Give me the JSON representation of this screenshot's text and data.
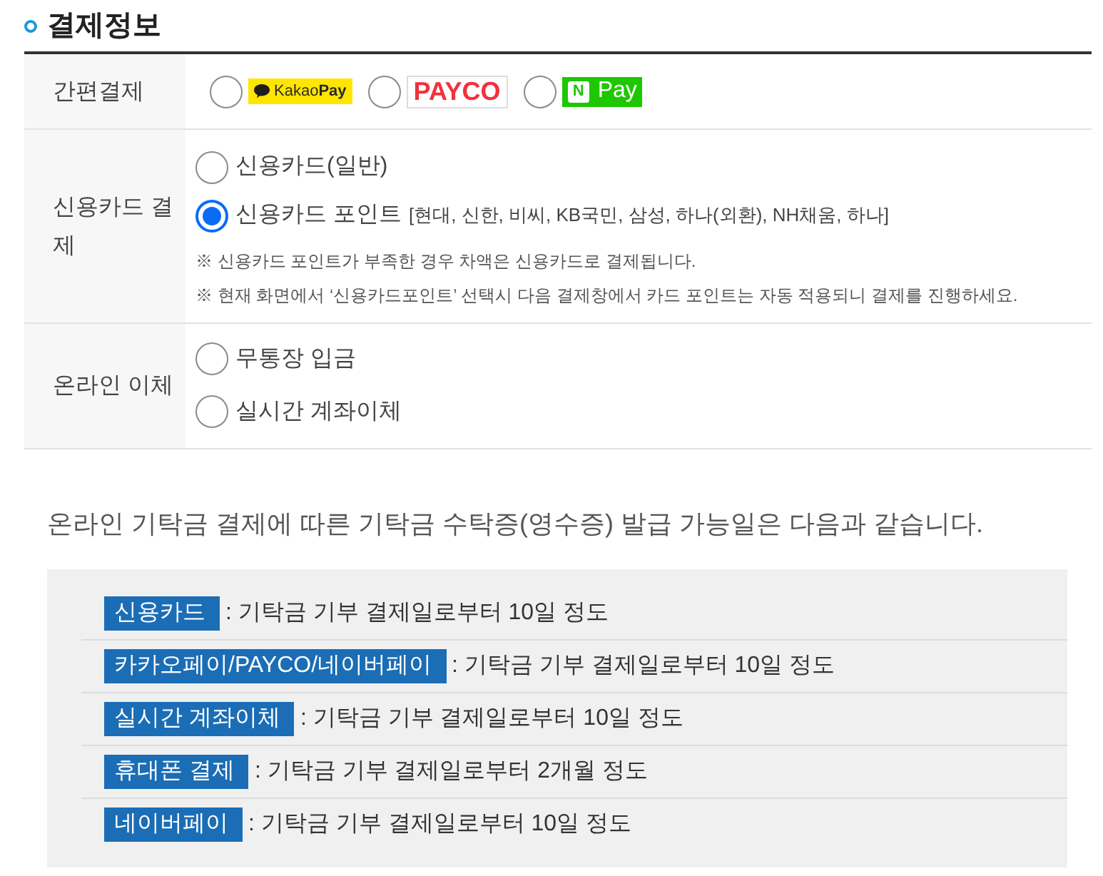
{
  "section": {
    "title": "결제정보"
  },
  "payment_rows": [
    {
      "label": "간편결제",
      "kind": "logos",
      "options": [
        {
          "kind": "kakaopay",
          "logo_text": "Kakao**Pay**",
          "selected": false
        },
        {
          "kind": "payco",
          "logo_text": "PAYCO",
          "selected": false
        },
        {
          "kind": "npay",
          "logo_mark": "N",
          "logo_text": "Pay",
          "selected": false
        }
      ]
    },
    {
      "label": "신용카드 결제",
      "kind": "text",
      "options": [
        {
          "label": "신용카드(일반)",
          "selected": false
        },
        {
          "label": "신용카드 포인트",
          "detail": "[현대, 신한, 비씨, KB국민, 삼성, 하나(외환), NH채움, 하나]",
          "selected": true
        }
      ],
      "notes": [
        "※ 신용카드 포인트가 부족한 경우 차액은 신용카드로 결제됩니다.",
        "※ 현재 화면에서 ‘신용카드포인트’ 선택시 다음 결제창에서 카드 포인트는 자동 적용되니 결제를 진행하세요."
      ]
    },
    {
      "label": "온라인 이체",
      "kind": "text",
      "options": [
        {
          "label": "무통장 입금",
          "selected": false
        },
        {
          "label": "실시간 계좌이체",
          "selected": false
        }
      ]
    }
  ],
  "receipt_info": {
    "intro": "온라인 기탁금 결제에 따른 기탁금 수탁증(영수증) 발급 가능일은 다음과 같습니다.",
    "items": [
      {
        "method": "신용카드",
        "period": ": 기탁금 기부 결제일로부터 10일 정도"
      },
      {
        "method": "카카오페이/PAYCO/네이버페이",
        "period": ": 기탁금 기부 결제일로부터 10일 정도"
      },
      {
        "method": "실시간 계좌이체",
        "period": ": 기탁금 기부 결제일로부터 10일 정도"
      },
      {
        "method": "휴대폰 결제",
        "period": ": 기탁금 기부 결제일로부터 2개월 정도"
      },
      {
        "method": "네이버페이",
        "period": ": 기탁금 기부 결제일로부터 10일 정도"
      }
    ]
  }
}
